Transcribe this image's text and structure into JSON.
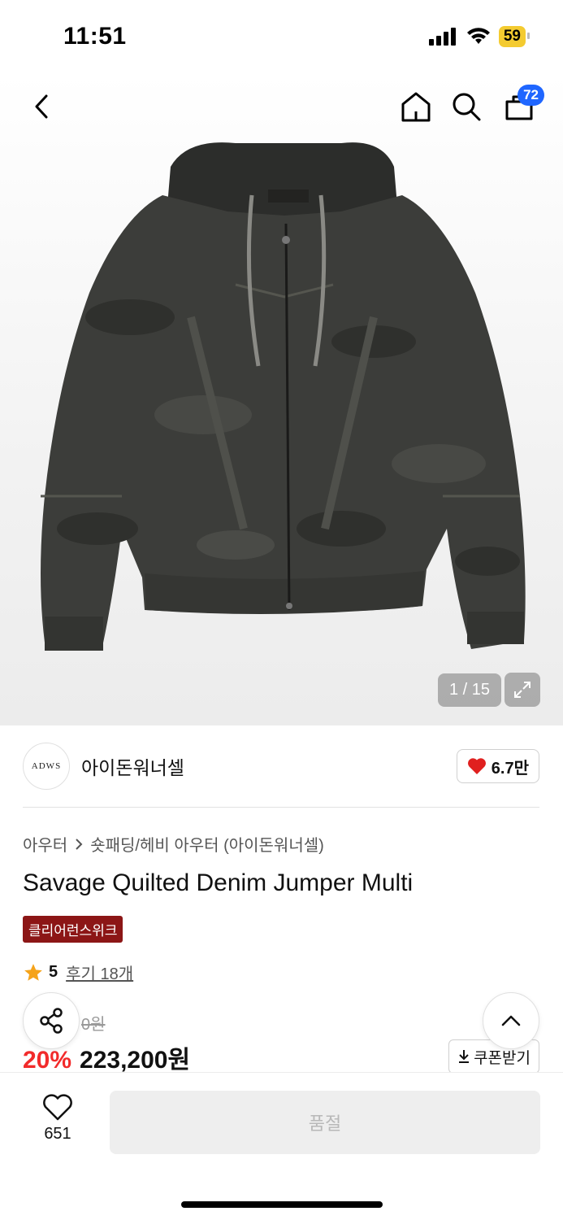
{
  "status": {
    "time": "11:51",
    "battery": "59"
  },
  "nav": {
    "cart_count": "72"
  },
  "gallery": {
    "counter": "1 / 15"
  },
  "brand": {
    "logo_text": "ADWS",
    "name": "아이돈워너셀",
    "favorites": "6.7만"
  },
  "breadcrumb": {
    "category": "아우터",
    "subcategory": "숏패딩/헤비 아우터 (아이돈워너셀)"
  },
  "product": {
    "title": "Savage Quilted Denim Jumper Multi",
    "tag": "클리어런스위크",
    "rating": "5",
    "reviews": "후기 18개",
    "original_price": "0원",
    "discount": "20%",
    "price": "223,200원"
  },
  "actions": {
    "coupon_label": "쿠폰받기",
    "like_count": "651",
    "buy_label": "품절"
  },
  "colors": {
    "accent_blue": "#1f66ff",
    "discount_red": "#f22b2b",
    "tag_bg": "#8c1616",
    "battery": "#f4cb30"
  }
}
